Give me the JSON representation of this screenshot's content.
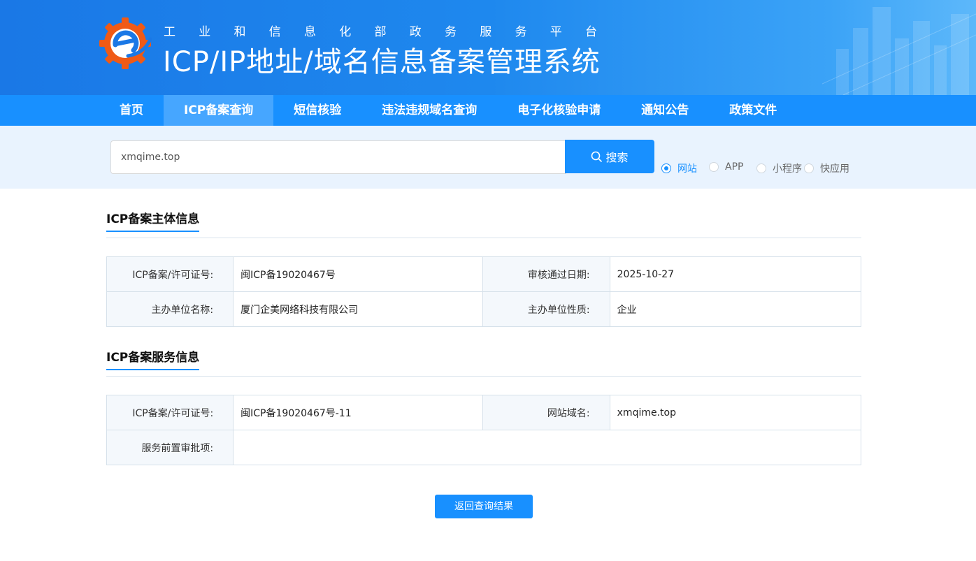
{
  "header": {
    "subtitle_chars": [
      "工",
      "业",
      "和",
      "信",
      "息",
      "化",
      "部",
      "政",
      "务",
      "服",
      "务",
      "平",
      "台"
    ],
    "title": "ICP/IP地址/域名信息备案管理系统",
    "brand_color": "#1a78e6"
  },
  "nav": {
    "items": [
      {
        "label": "首页",
        "active": false
      },
      {
        "label": "ICP备案查询",
        "active": true
      },
      {
        "label": "短信核验",
        "active": false
      },
      {
        "label": "违法违规域名查询",
        "active": false
      },
      {
        "label": "电子化核验申请",
        "active": false
      },
      {
        "label": "通知公告",
        "active": false
      },
      {
        "label": "政策文件",
        "active": false
      }
    ]
  },
  "search": {
    "value": "xmqime.top",
    "button_label": "搜索",
    "button_icon": "search-icon",
    "types": [
      {
        "label": "网站",
        "checked": true
      },
      {
        "label": "APP",
        "checked": false
      },
      {
        "label": "小程序",
        "checked": false
      },
      {
        "label": "快应用",
        "checked": false
      }
    ]
  },
  "subject_info": {
    "title": "ICP备案主体信息",
    "license_label": "ICP备案/许可证号:",
    "license_value": "闽ICP备19020467号",
    "approve_date_label": "审核通过日期:",
    "approve_date_value": "2025-10-27",
    "org_name_label": "主办单位名称:",
    "org_name_value": "厦门企美网络科技有限公司",
    "org_type_label": "主办单位性质:",
    "org_type_value": "企业"
  },
  "service_info": {
    "title": "ICP备案服务信息",
    "license_label": "ICP备案/许可证号:",
    "license_value": "闽ICP备19020467号-11",
    "domain_label": "网站域名:",
    "domain_value": "xmqime.top",
    "approval_items_label": "服务前置审批项:",
    "approval_items_value": ""
  },
  "back_button_label": "返回查询结果",
  "accent_color": "#1890ff"
}
